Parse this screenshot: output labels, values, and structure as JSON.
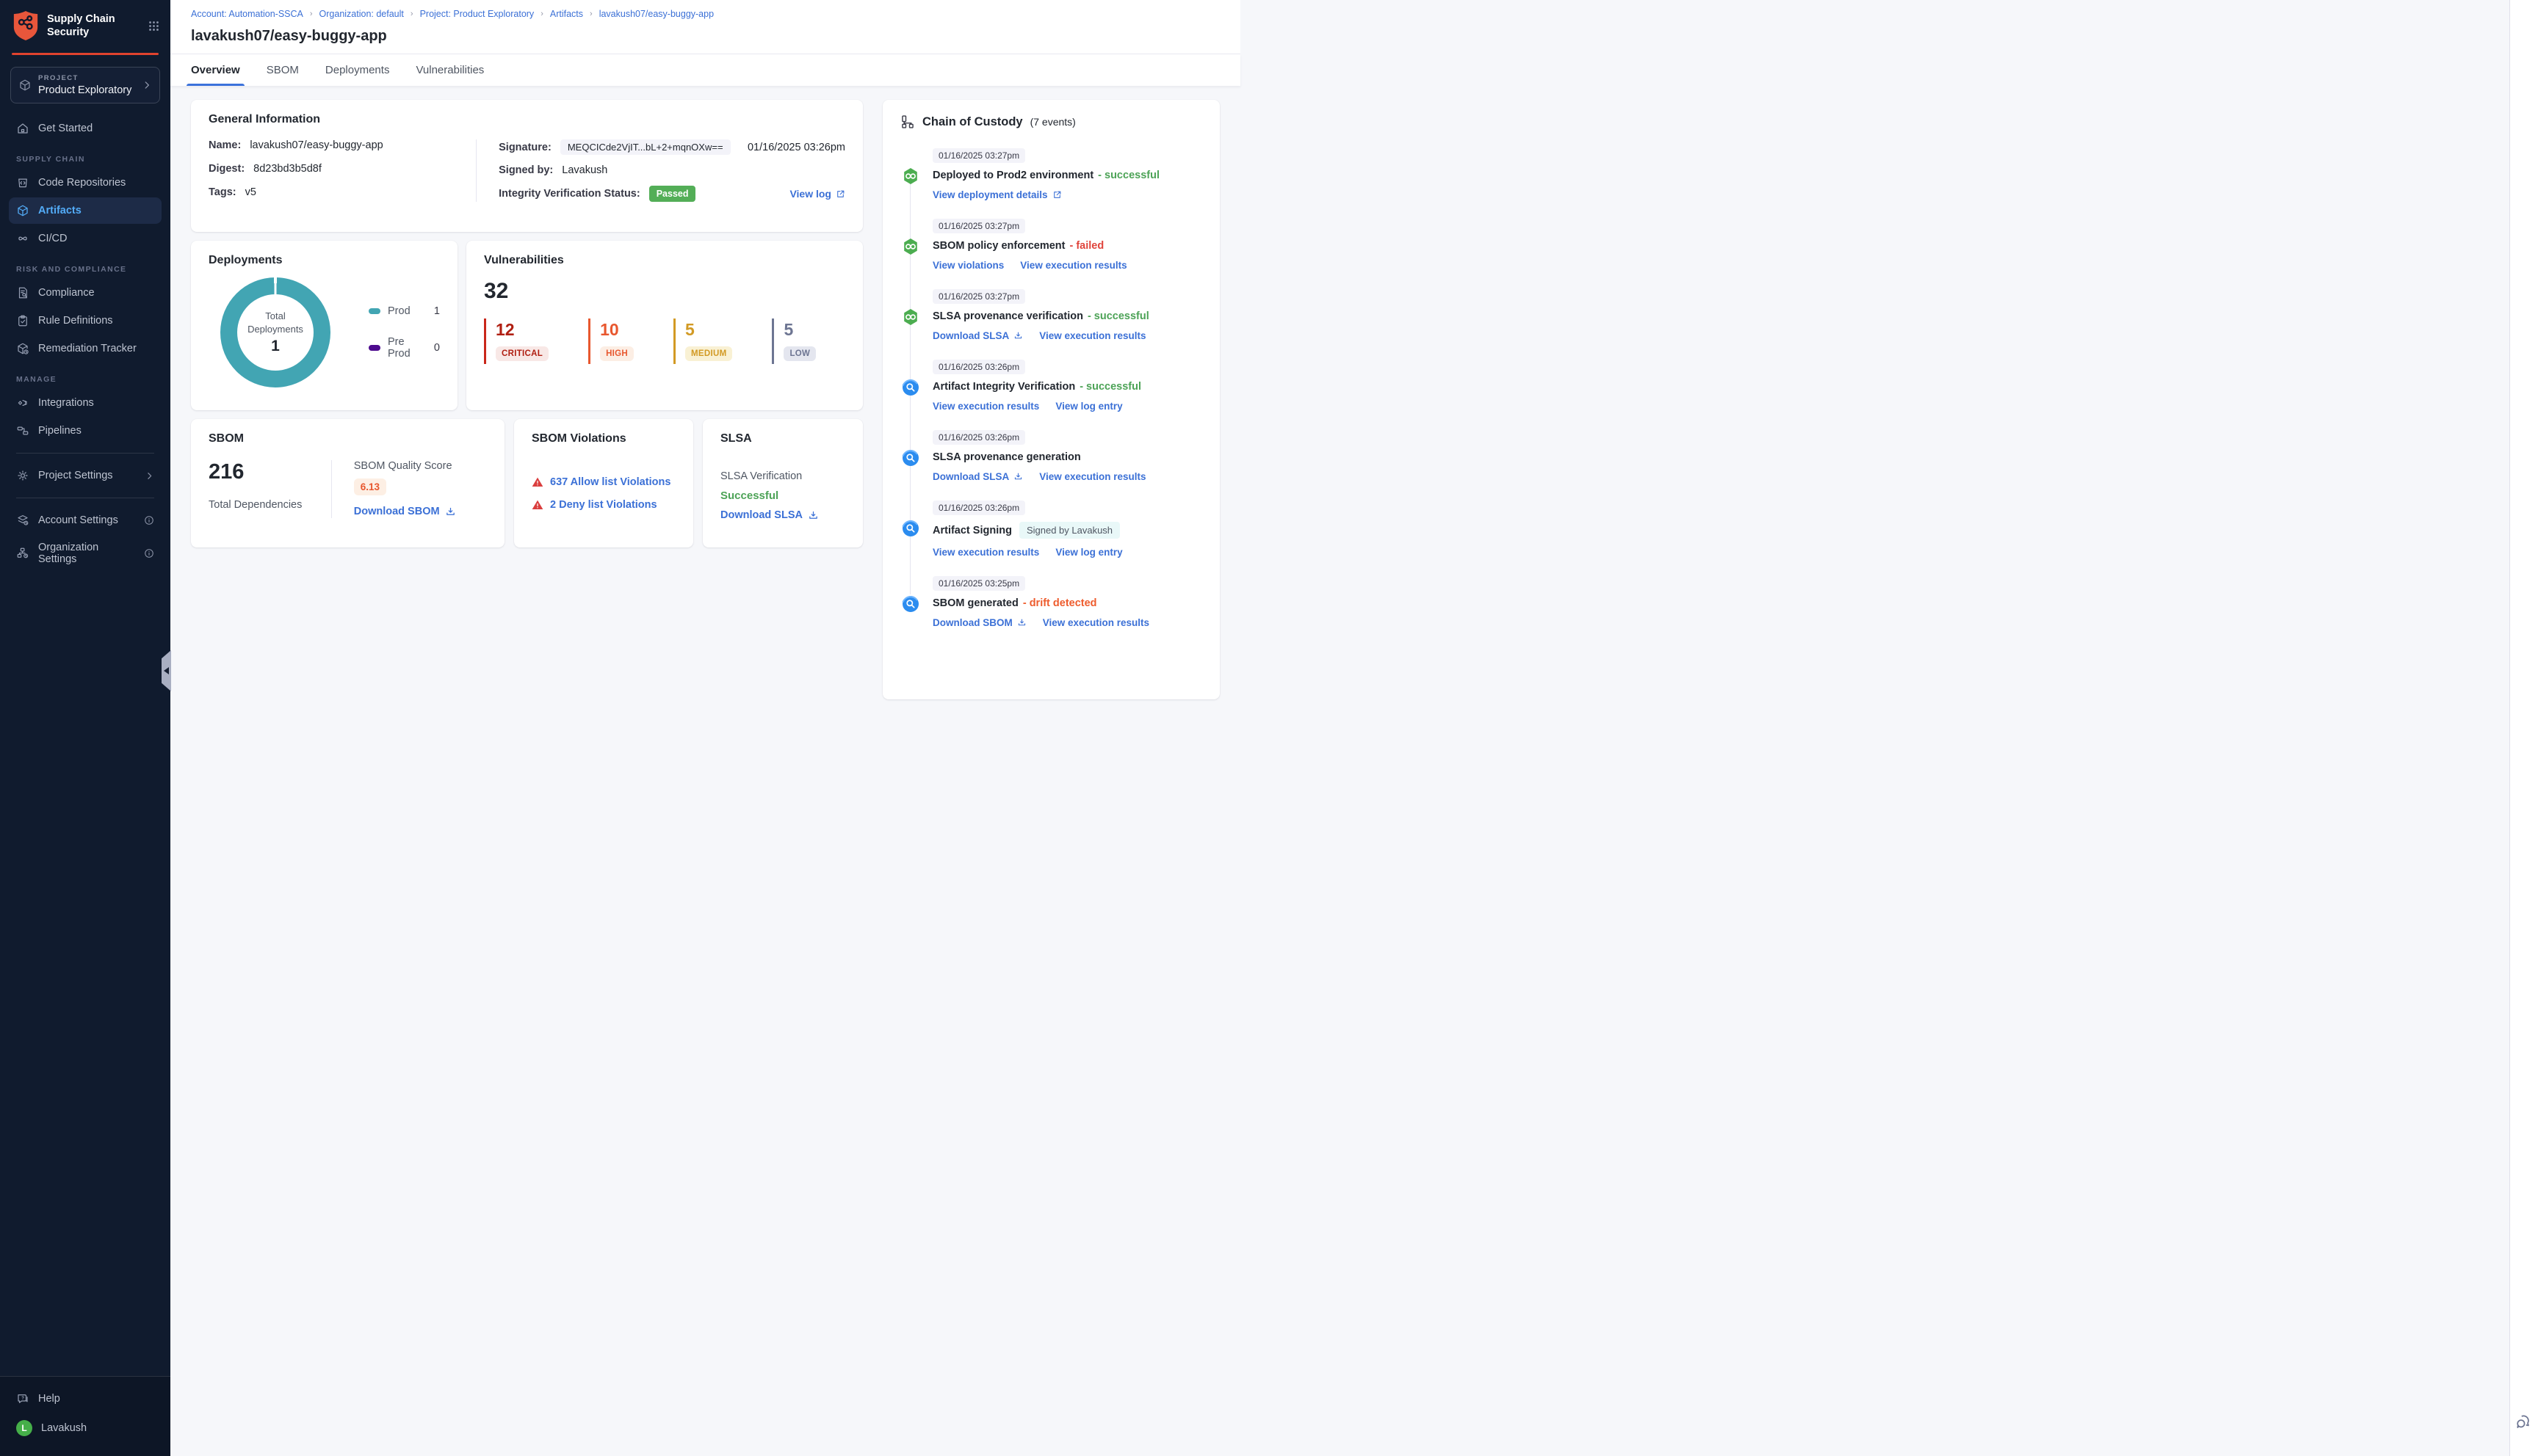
{
  "colors": {
    "sidebar_bg": "#101B2E",
    "brand_accent": "#E0432E",
    "link_blue": "#3B70D6",
    "active_nav_blue": "#53ACF8",
    "success_green": "#4DA357",
    "fail_red": "#E0443C",
    "drift_orange": "#EE5C2D",
    "passed_badge_green": "#53AE57",
    "donut_teal": "#42A5B3",
    "preprod_purple": "#4D0B8E",
    "critical": "#B01F12",
    "high": "#E8572E",
    "medium": "#D29A24",
    "low": "#6D7592"
  },
  "sidebar": {
    "app_title_line1": "Supply Chain",
    "app_title_line2": "Security",
    "project_label": "PROJECT",
    "project_name": "Product Exploratory",
    "sections": {
      "supply_chain": "SUPPLY CHAIN",
      "risk": "RISK AND COMPLIANCE",
      "manage": "MANAGE"
    },
    "items": {
      "get_started": "Get Started",
      "code_repositories": "Code Repositories",
      "artifacts": "Artifacts",
      "cicd": "CI/CD",
      "compliance": "Compliance",
      "rule_definitions": "Rule Definitions",
      "remediation_tracker": "Remediation Tracker",
      "integrations": "Integrations",
      "pipelines": "Pipelines",
      "project_settings": "Project Settings",
      "account_settings": "Account Settings",
      "organization_settings": "Organization Settings"
    },
    "footer": {
      "help": "Help",
      "user": "Lavakush",
      "avatar_initial": "L"
    }
  },
  "breadcrumb": {
    "separator": "›",
    "items": [
      "Account: Automation-SSCA",
      "Organization: default",
      "Project: Product Exploratory",
      "Artifacts",
      "lavakush07/easy-buggy-app"
    ]
  },
  "header": {
    "title": "lavakush07/easy-buggy-app"
  },
  "tabs": [
    "Overview",
    "SBOM",
    "Deployments",
    "Vulnerabilities"
  ],
  "general_info": {
    "title": "General Information",
    "name_label": "Name:",
    "name": "lavakush07/easy-buggy-app",
    "digest_label": "Digest:",
    "digest": "8d23bd3b5d8f",
    "tags_label": "Tags:",
    "tags": "v5",
    "signature_label": "Signature:",
    "signature": "MEQCICde2VjIT...bL+2+mqnOXw==",
    "signature_time": "01/16/2025 03:26pm",
    "signed_by_label": "Signed by:",
    "signed_by": "Lavakush",
    "integrity_label": "Integrity Verification Status:",
    "integrity_status": "Passed",
    "view_log": "View log"
  },
  "deployments": {
    "title": "Deployments",
    "center_label": "Total Deployments",
    "total": "1",
    "legend": [
      {
        "label": "Prod",
        "value": "1",
        "color": "#42A5B3"
      },
      {
        "label": "Pre Prod",
        "value": "0",
        "color": "#4D0B8E"
      }
    ],
    "chart": {
      "type": "pie",
      "categories": [
        "Prod",
        "Pre Prod"
      ],
      "values": [
        1,
        0
      ],
      "title": "Total Deployments"
    }
  },
  "vulnerabilities": {
    "title": "Vulnerabilities",
    "total": "32",
    "severities": [
      {
        "label": "CRITICAL",
        "value": "12",
        "color": "#B01F12"
      },
      {
        "label": "HIGH",
        "value": "10",
        "color": "#E8572E"
      },
      {
        "label": "MEDIUM",
        "value": "5",
        "color": "#D29A24"
      },
      {
        "label": "LOW",
        "value": "5",
        "color": "#6D7592"
      }
    ]
  },
  "sbom": {
    "title": "SBOM",
    "total": "216",
    "total_label": "Total Dependencies",
    "quality_label": "SBOM Quality Score",
    "quality_score": "6.13",
    "download_label": "Download SBOM"
  },
  "sbom_violations": {
    "title": "SBOM Violations",
    "items": [
      "637 Allow list Violations",
      "2 Deny list Violations"
    ]
  },
  "slsa": {
    "title": "SLSA",
    "verification_label": "SLSA Verification",
    "status": "Successful",
    "download_label": "Download SLSA"
  },
  "chain_of_custody": {
    "title": "Chain of Custody",
    "count": "(7 events)",
    "events": [
      {
        "time": "01/16/2025 03:27pm",
        "title": "Deployed to Prod2 environment",
        "status": "- successful",
        "links": [
          {
            "text": "View deployment details"
          }
        ]
      },
      {
        "time": "01/16/2025 03:27pm",
        "title": "SBOM policy enforcement",
        "status": "- failed",
        "links": [
          {
            "text": "View violations"
          },
          {
            "text": "View execution results"
          }
        ]
      },
      {
        "time": "01/16/2025 03:27pm",
        "title": "SLSA provenance verification",
        "status": "- successful",
        "links": [
          {
            "text": "Download SLSA"
          },
          {
            "text": "View execution results"
          }
        ]
      },
      {
        "time": "01/16/2025 03:26pm",
        "title": "Artifact Integrity Verification",
        "status": "- successful",
        "links": [
          {
            "text": "View execution results"
          },
          {
            "text": "View log entry"
          }
        ]
      },
      {
        "time": "01/16/2025 03:26pm",
        "title": "SLSA provenance generation",
        "links": [
          {
            "text": "Download SLSA"
          },
          {
            "text": "View execution results"
          }
        ]
      },
      {
        "time": "01/16/2025 03:26pm",
        "title": "Artifact Signing",
        "badge": "Signed by Lavakush",
        "links": [
          {
            "text": "View execution results"
          },
          {
            "text": "View log entry"
          }
        ]
      },
      {
        "time": "01/16/2025 03:25pm",
        "title": "SBOM generated",
        "status": "- drift detected",
        "links": [
          {
            "text": "Download SBOM"
          },
          {
            "text": "View execution results"
          }
        ]
      }
    ]
  }
}
